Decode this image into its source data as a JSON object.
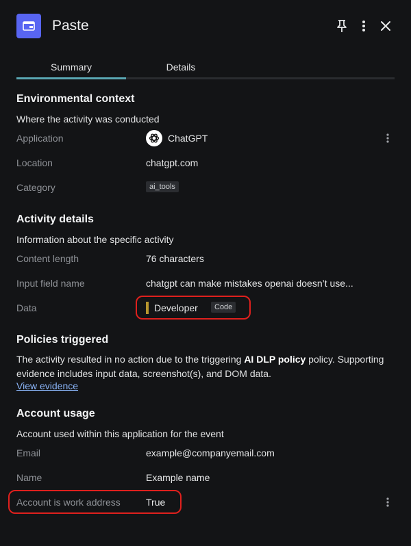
{
  "header": {
    "title": "Paste",
    "icon": "window-icon",
    "accent": "#5865f2"
  },
  "tabs": [
    {
      "label": "Summary",
      "active": true
    },
    {
      "label": "Details",
      "active": false
    }
  ],
  "environmental": {
    "title": "Environmental context",
    "subtitle": "Where the activity was conducted",
    "rows": [
      {
        "label": "Application",
        "value": "ChatGPT",
        "icon": "chatgpt-logo-icon"
      },
      {
        "label": "Location",
        "value": "chatgpt.com"
      },
      {
        "label": "Category",
        "value": "ai_tools"
      }
    ]
  },
  "activity": {
    "title": "Activity details",
    "subtitle": "Information about the specific activity",
    "rows": [
      {
        "label": "Content length",
        "value": "76 characters"
      },
      {
        "label": "Input field name",
        "value": "chatgpt can make mistakes openai doesn’t use..."
      },
      {
        "label": "Data",
        "value": "Developer",
        "tag": "Code"
      }
    ]
  },
  "policies": {
    "title": "Policies triggered",
    "text_before": "The activity resulted in no action due to the triggering ",
    "policy_name": "AI DLP policy",
    "text_after": " policy. Supporting evidence includes input data, screenshot(s), and DOM data.",
    "link": "View evidence"
  },
  "account": {
    "title": "Account usage",
    "subtitle": "Account used within this application for the event",
    "rows": [
      {
        "label": "Email",
        "value": "example@companyemail.com"
      },
      {
        "label": "Name",
        "value": "Example name"
      },
      {
        "label": "Account is work address",
        "value": "True"
      }
    ]
  },
  "colors": {
    "background": "#131416",
    "highlight": "#e0201d",
    "link": "#8ab4f8",
    "tab_indicator": "#5aa7b3",
    "data_marker": "#b8962e"
  }
}
